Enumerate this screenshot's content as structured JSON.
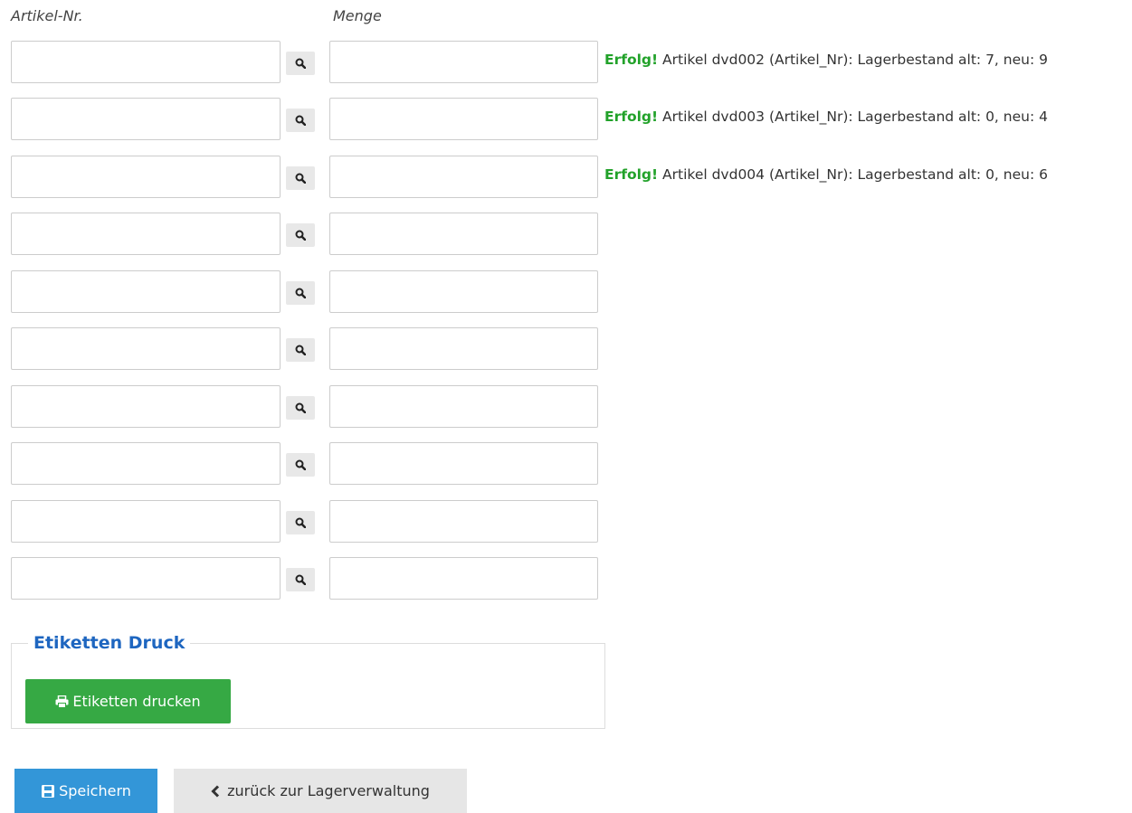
{
  "headers": {
    "artikel": "Artikel-Nr.",
    "menge": "Menge"
  },
  "rows": [
    {
      "artikel_value": "",
      "menge_value": "",
      "message_prefix": "Erfolg!",
      "message_text": " Artikel dvd002 (Artikel_Nr): Lagerbestand alt: 7, neu: 9"
    },
    {
      "artikel_value": "",
      "menge_value": "",
      "message_prefix": "Erfolg!",
      "message_text": " Artikel dvd003 (Artikel_Nr): Lagerbestand alt: 0, neu: 4"
    },
    {
      "artikel_value": "",
      "menge_value": "",
      "message_prefix": "Erfolg!",
      "message_text": " Artikel dvd004 (Artikel_Nr): Lagerbestand alt: 0, neu: 6"
    },
    {
      "artikel_value": "",
      "menge_value": ""
    },
    {
      "artikel_value": "",
      "menge_value": ""
    },
    {
      "artikel_value": "",
      "menge_value": ""
    },
    {
      "artikel_value": "",
      "menge_value": ""
    },
    {
      "artikel_value": "",
      "menge_value": ""
    },
    {
      "artikel_value": "",
      "menge_value": ""
    },
    {
      "artikel_value": "",
      "menge_value": ""
    }
  ],
  "print": {
    "legend": "Etiketten Druck",
    "button_label": "Etiketten drucken",
    "icon": "print-icon"
  },
  "actions": {
    "save_label": "Speichern",
    "save_icon": "floppy-disk-icon",
    "back_label": "zurück zur Lagerverwaltung",
    "back_icon": "chevron-left-icon"
  },
  "colors": {
    "success": "#22a22a",
    "legend": "#1e66c0",
    "print_button": "#36a944",
    "save_button": "#3396d8",
    "back_button": "#e6e6e6"
  }
}
